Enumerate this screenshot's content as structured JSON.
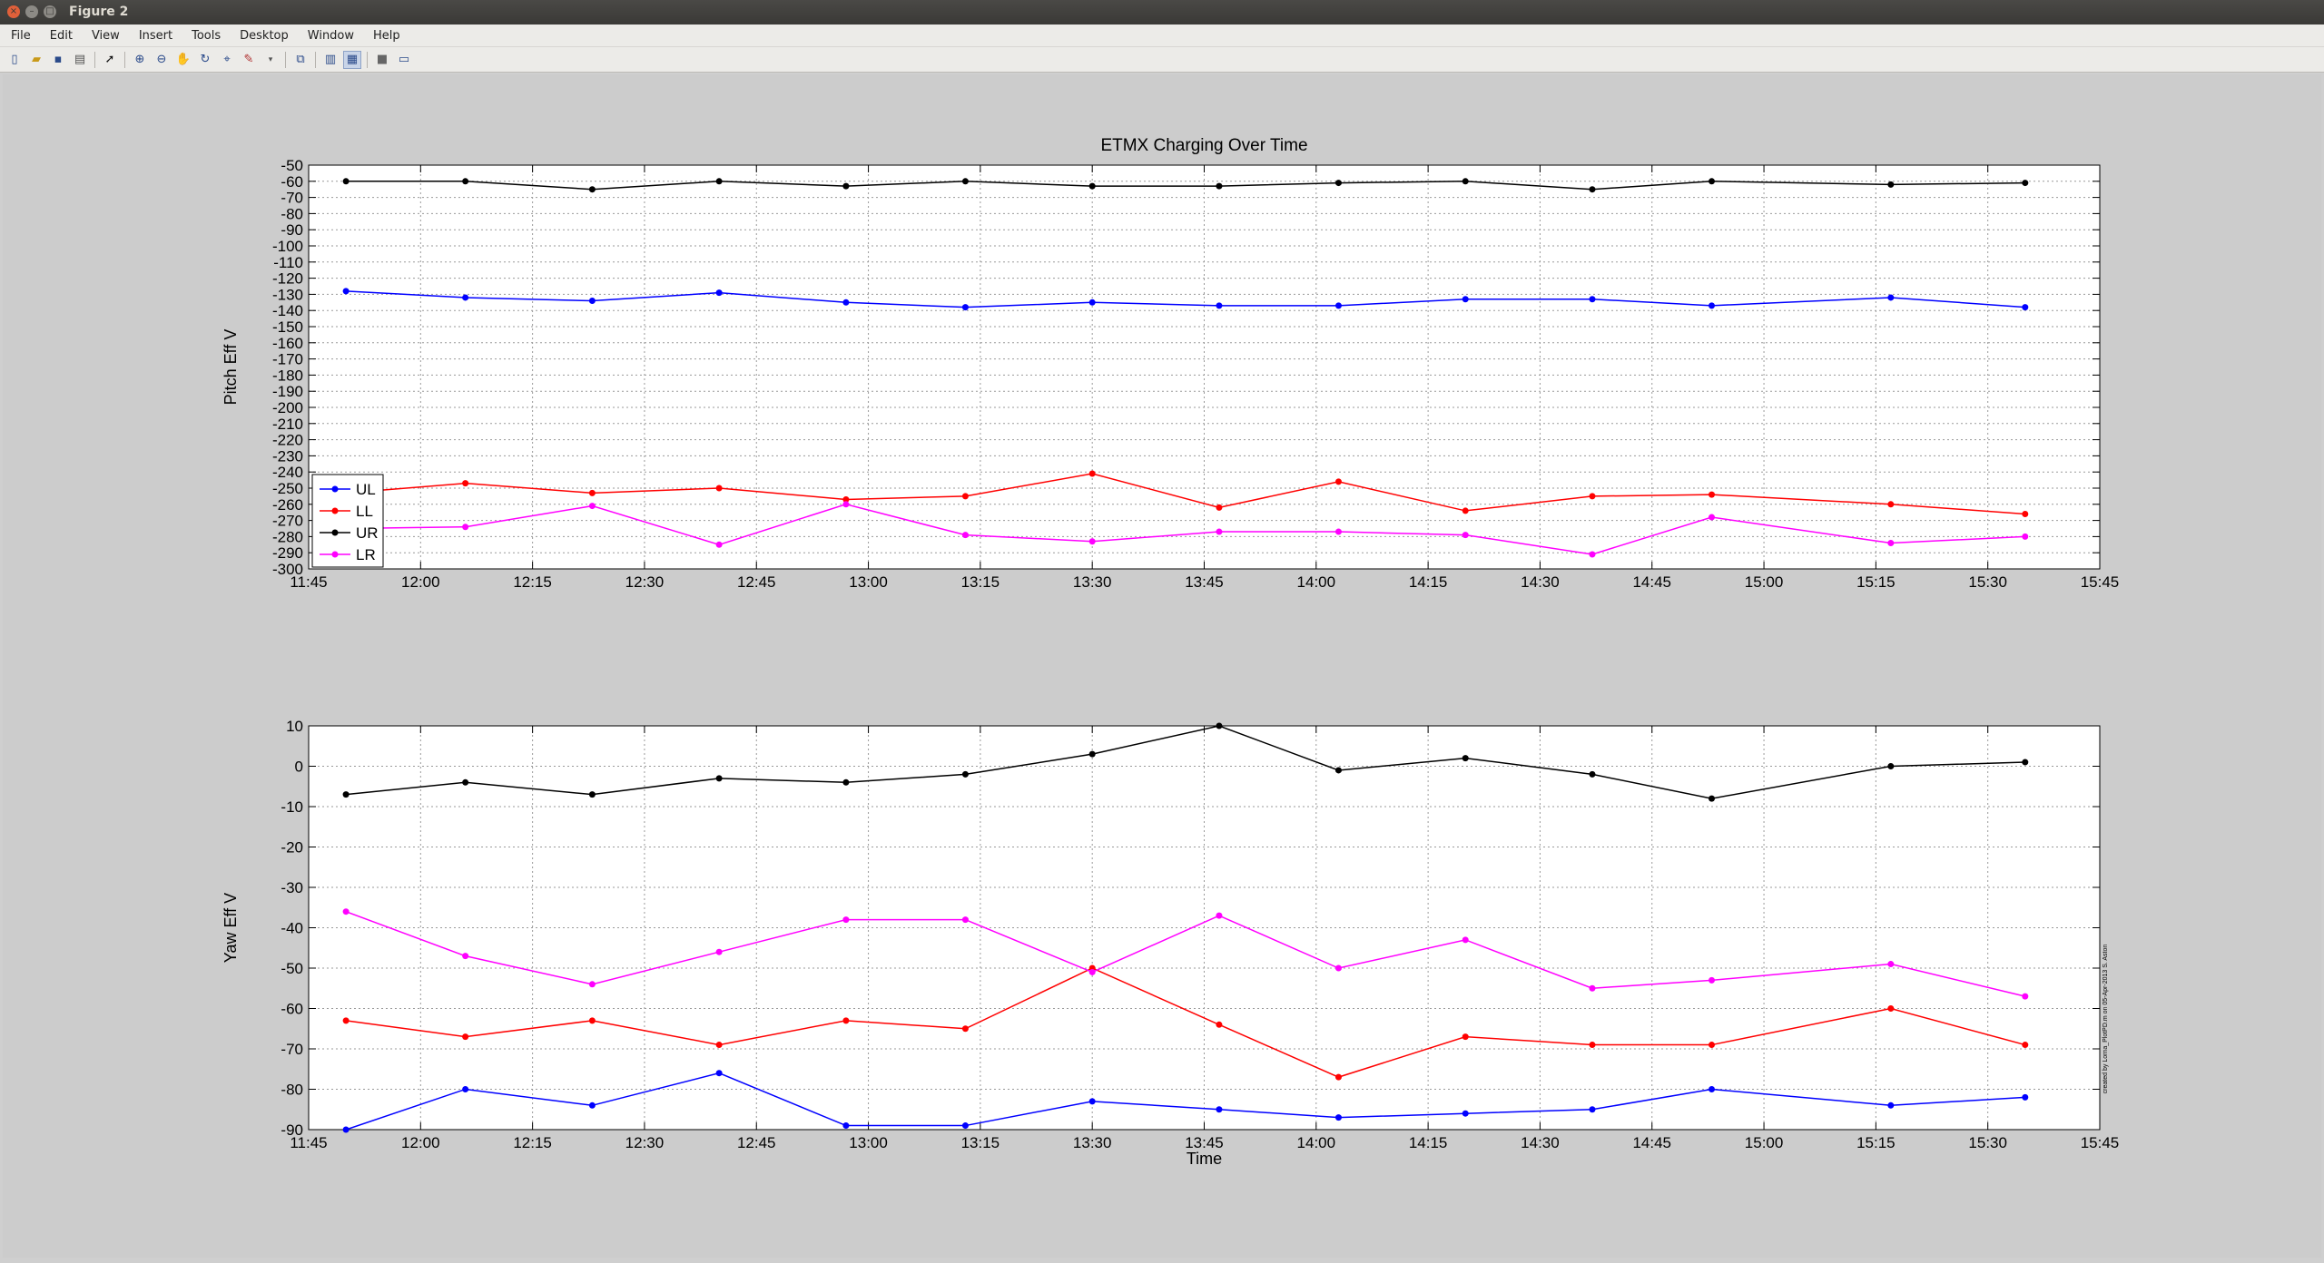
{
  "window": {
    "title": "Figure 2"
  },
  "menu": {
    "items": [
      "File",
      "Edit",
      "View",
      "Insert",
      "Tools",
      "Desktop",
      "Window",
      "Help"
    ]
  },
  "toolbar": {
    "icons": [
      "new-figure-icon",
      "open-file-icon",
      "save-icon",
      "print-icon",
      "pointer-icon",
      "zoom-in-icon",
      "zoom-out-icon",
      "pan-icon",
      "rotate-icon",
      "data-cursor-icon",
      "brush-icon",
      "link-icon",
      "colorbar-icon",
      "legend-icon",
      "hide-plot-tools-icon",
      "show-plot-tools-icon"
    ]
  },
  "side_note": "created by Lorna_PlotPD.m on 05-Apr-2013 S. Aston",
  "chart_data": [
    {
      "type": "line",
      "title": "ETMX Charging Over Time",
      "ylabel": "Pitch Eff V",
      "xlabel": "",
      "xlim": [
        705,
        945
      ],
      "ylim": [
        -300,
        -50
      ],
      "grid": true,
      "xticks": [
        "11:45",
        "12:00",
        "12:15",
        "12:30",
        "12:45",
        "13:00",
        "13:15",
        "13:30",
        "13:45",
        "14:00",
        "14:15",
        "14:30",
        "14:45",
        "15:00",
        "15:15",
        "15:30",
        "15:45"
      ],
      "yticks": [
        -50,
        -60,
        -70,
        -80,
        -90,
        -100,
        -110,
        -120,
        -130,
        -140,
        -150,
        -160,
        -170,
        -180,
        -190,
        -200,
        -210,
        -220,
        -230,
        -240,
        -250,
        -260,
        -270,
        -280,
        -290,
        -300
      ],
      "legend": {
        "location": "lower-left",
        "entries": [
          "UL",
          "LL",
          "UR",
          "LR"
        ]
      },
      "x": [
        710,
        726,
        743,
        760,
        777,
        793,
        810,
        827,
        843,
        860,
        877,
        893,
        917,
        935
      ],
      "series": [
        {
          "name": "UL",
          "color": "#0000ff",
          "values": [
            -128,
            -132,
            -134,
            -129,
            -135,
            -138,
            -135,
            -137,
            -137,
            -133,
            -133,
            -137,
            -132,
            -138
          ]
        },
        {
          "name": "LL",
          "color": "#ff0000",
          "values": [
            -253,
            -247,
            -253,
            -250,
            -257,
            -255,
            -241,
            -262,
            -246,
            -264,
            -255,
            -254,
            -260,
            -266
          ]
        },
        {
          "name": "UR",
          "color": "#000000",
          "values": [
            -60,
            -60,
            -65,
            -60,
            -63,
            -60,
            -63,
            -63,
            -61,
            -60,
            -65,
            -60,
            -62,
            -61
          ]
        },
        {
          "name": "LR",
          "color": "#ff00ff",
          "values": [
            -275,
            -274,
            -261,
            -285,
            -260,
            -279,
            -283,
            -277,
            -277,
            -279,
            -291,
            -268,
            -284,
            -280
          ]
        }
      ]
    },
    {
      "type": "line",
      "title": "",
      "ylabel": "Yaw Eff V",
      "xlabel": "Time",
      "xlim": [
        705,
        945
      ],
      "ylim": [
        -90,
        10
      ],
      "grid": true,
      "xticks": [
        "11:45",
        "12:00",
        "12:15",
        "12:30",
        "12:45",
        "13:00",
        "13:15",
        "13:30",
        "13:45",
        "14:00",
        "14:15",
        "14:30",
        "14:45",
        "15:00",
        "15:15",
        "15:30",
        "15:45"
      ],
      "yticks": [
        10,
        0,
        -10,
        -20,
        -30,
        -40,
        -50,
        -60,
        -70,
        -80,
        -90
      ],
      "x": [
        710,
        726,
        743,
        760,
        777,
        793,
        810,
        827,
        843,
        860,
        877,
        893,
        917,
        935
      ],
      "series": [
        {
          "name": "UL",
          "color": "#0000ff",
          "values": [
            -90,
            -80,
            -84,
            -76,
            -89,
            -89,
            -83,
            -85,
            -87,
            -86,
            -85,
            -80,
            -84,
            -82
          ]
        },
        {
          "name": "LL",
          "color": "#ff0000",
          "values": [
            -63,
            -67,
            -63,
            -69,
            -63,
            -65,
            -50,
            -64,
            -77,
            -67,
            -69,
            -69,
            -60,
            -69
          ]
        },
        {
          "name": "UR",
          "color": "#000000",
          "values": [
            -7,
            -4,
            -7,
            -3,
            -4,
            -2,
            3,
            10,
            -1,
            2,
            -2,
            -8,
            0,
            1
          ]
        },
        {
          "name": "LR",
          "color": "#ff00ff",
          "values": [
            -36,
            -47,
            -54,
            -46,
            -38,
            -38,
            -51,
            -37,
            -50,
            -43,
            -55,
            -53,
            -49,
            -57
          ]
        }
      ]
    }
  ]
}
